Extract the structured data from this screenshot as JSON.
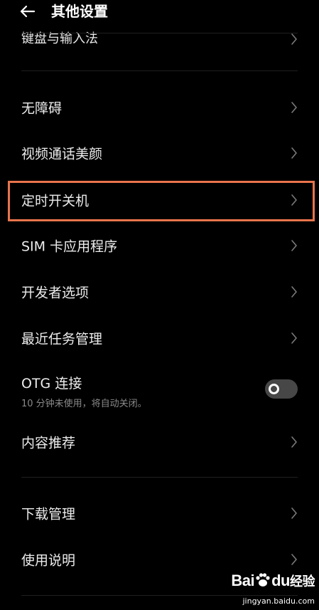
{
  "header": {
    "title": "其他设置",
    "back_icon": "arrow-left-icon"
  },
  "partial_item": {
    "label": "键盘与输入法"
  },
  "items": [
    {
      "label": "无障碍"
    },
    {
      "label": "视频通话美颜"
    },
    {
      "label": "定时开关机"
    },
    {
      "label": "SIM 卡应用程序"
    },
    {
      "label": "开发者选项"
    },
    {
      "label": "最近任务管理"
    }
  ],
  "otg": {
    "label": "OTG 连接",
    "sub": "10 分钟未使用，将自动关闭。",
    "toggle_state": "off"
  },
  "items2": [
    {
      "label": "内容推荐"
    }
  ],
  "items3": [
    {
      "label": "下载管理"
    },
    {
      "label": "使用说明"
    }
  ],
  "colors": {
    "background": "#000000",
    "highlight": "#e8744c",
    "toggle_track": "#474747"
  },
  "watermark": {
    "logo_left": "Bai",
    "logo_mid": "du",
    "logo_right": "经验",
    "url": "jingyan.baidu.com"
  }
}
